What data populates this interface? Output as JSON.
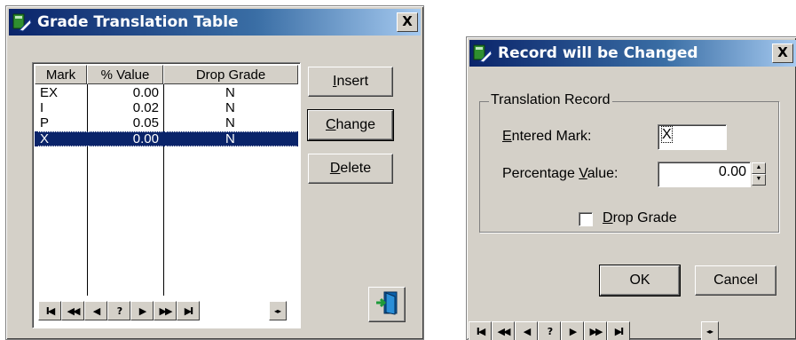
{
  "grade_window": {
    "title": "Grade Translation Table",
    "close": "X",
    "columns": [
      "Mark",
      "% Value",
      "Drop Grade"
    ],
    "rows": [
      {
        "mark": "EX",
        "value": "0.00",
        "drop": "N"
      },
      {
        "mark": "I",
        "value": "0.02",
        "drop": "N"
      },
      {
        "mark": "P",
        "value": "0.05",
        "drop": "N"
      },
      {
        "mark": "X",
        "value": "0.00",
        "drop": "N",
        "selected": true
      }
    ],
    "insert_pre": "",
    "insert_accel": "I",
    "insert_post": "nsert",
    "change_pre": "",
    "change_accel": "C",
    "change_post": "hange",
    "delete_pre": "",
    "delete_accel": "D",
    "delete_post": "elete",
    "nav": [
      "I◀",
      "◀◀",
      "◀",
      "?",
      "▶",
      "▶▶",
      "▶I"
    ]
  },
  "record_window": {
    "title": "Record will be Changed",
    "close": "X",
    "group_label": "Translation Record",
    "entered_mark_accel": "E",
    "entered_mark_rest": "ntered Mark:",
    "entered_mark_value": "X",
    "percent_pre": "Percentage ",
    "percent_accel": "V",
    "percent_post": "alue:",
    "percent_value": "0.00",
    "drop_accel": "D",
    "drop_rest": "rop Grade",
    "ok_label": "OK",
    "cancel_label": "Cancel",
    "nav": [
      "I◀",
      "◀◀",
      "◀",
      "?",
      "▶",
      "▶▶",
      "▶I"
    ]
  },
  "colors": {
    "face": "#d4d0c8",
    "title_active": "#0a246a",
    "selection": "#0a246a"
  }
}
